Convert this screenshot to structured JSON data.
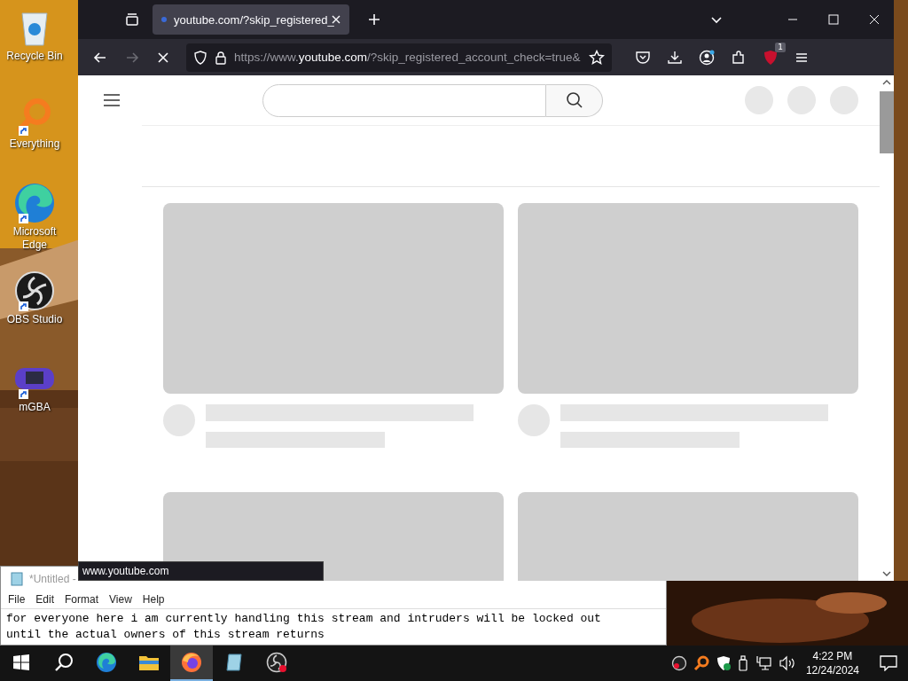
{
  "desktop_icons": [
    {
      "label": "Recycle Bin",
      "kind": "recycle",
      "shortcut": false
    },
    {
      "label": "Everything",
      "kind": "everything",
      "shortcut": true
    },
    {
      "label": "Microsoft Edge",
      "kind": "edge",
      "shortcut": true
    },
    {
      "label": "OBS Studio",
      "kind": "obs",
      "shortcut": true
    },
    {
      "label": "mGBA",
      "kind": "mgba",
      "shortcut": true
    }
  ],
  "browser": {
    "tabs": [
      {
        "title": "youtube.com/?skip_registered_",
        "selected": true
      }
    ],
    "forward_disabled": true,
    "loading": true,
    "url": {
      "scheme": "https://www.",
      "host": "youtube.com",
      "rest": "/?skip_registered_account_check=true&"
    },
    "extension_badge": "1",
    "status_link": "www.youtube.com"
  },
  "notepad": {
    "title": "*Untitled -",
    "menu": [
      "File",
      "Edit",
      "Format",
      "View",
      "Help"
    ],
    "lines": [
      "for everyone here i am currently handling this stream and intruders will be locked out",
      "until the actual owners of this stream returns"
    ]
  },
  "taskbar": {
    "apps": [
      {
        "kind": "start",
        "active": false
      },
      {
        "kind": "search",
        "active": false
      },
      {
        "kind": "edge",
        "active": false
      },
      {
        "kind": "explorer",
        "active": false
      },
      {
        "kind": "firefox",
        "active": true
      },
      {
        "kind": "notepad",
        "active": false
      },
      {
        "kind": "obs",
        "active": false
      }
    ],
    "time": "4:22 PM",
    "date": "12/24/2024"
  }
}
